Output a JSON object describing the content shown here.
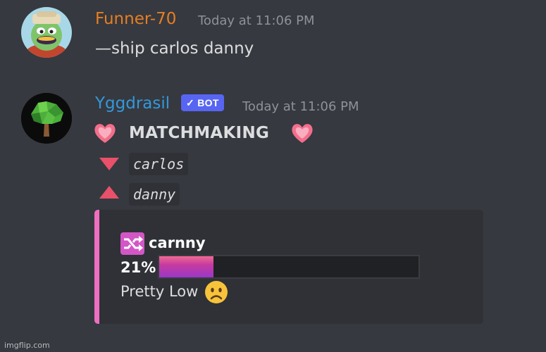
{
  "messages": [
    {
      "username": "Funner-70",
      "timestamp": "Today at 11:06 PM",
      "content": "—ship carlos danny",
      "name_color": "#e67e22"
    },
    {
      "username": "Yggdrasil",
      "badge": "✓ BOT",
      "timestamp": "Today at 11:06 PM",
      "name_color": "#3498db",
      "title": "MATCHMAKING",
      "names": [
        "carlos",
        "danny"
      ],
      "embed": {
        "title": "carnny",
        "percent_label": "21%",
        "percent": 0.21,
        "rating": "Pretty Low",
        "accent": "#ee6fbf"
      }
    }
  ],
  "icons": {
    "heart": "sparkling-heart-icon",
    "down": "down-triangle-icon",
    "up": "up-triangle-icon",
    "shuffle": "shuffle-icon",
    "sad": "frowning-face-icon"
  },
  "watermark": "imgflip.com"
}
